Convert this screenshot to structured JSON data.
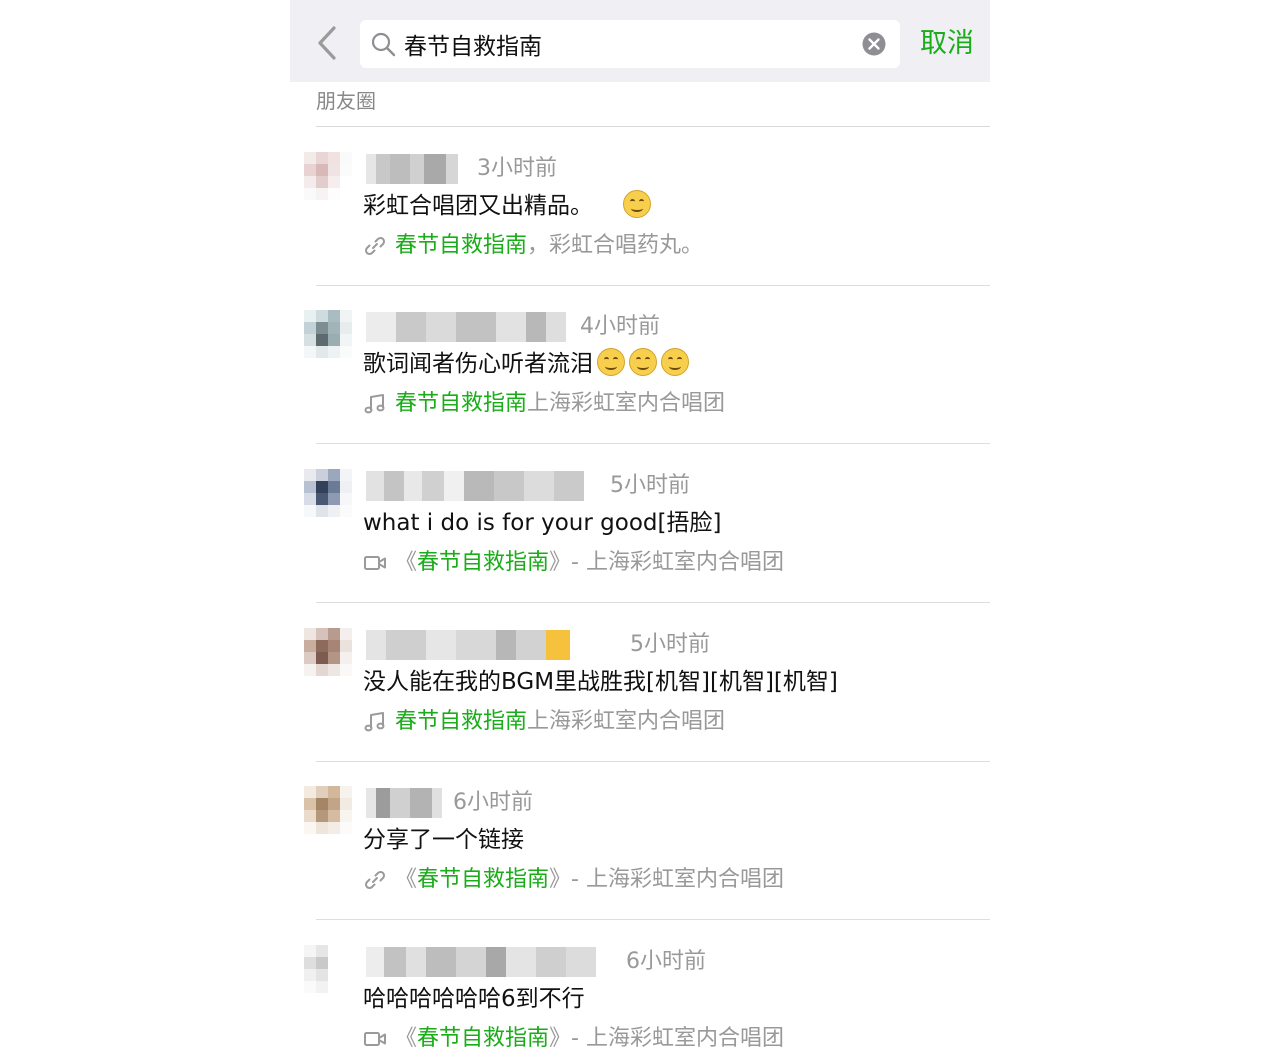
{
  "search": {
    "query": "春节自救指南",
    "cancel_label": "取消"
  },
  "section_label": "朋友圈",
  "results": [
    {
      "time": "3小时前",
      "text": "彩虹合唱团又出精品。",
      "emoji": "laughing-tears",
      "share_type": "link-icon",
      "share_prefix": "",
      "share_highlight": "春节自救指南",
      "share_rest": "，彩虹合唱药丸。"
    },
    {
      "time": "4小时前",
      "text": "歌词闻者伤心听者流泪",
      "emoji": "blush x3",
      "share_type": "music-icon",
      "share_prefix": "",
      "share_highlight": "春节自救指南",
      "share_rest": " 上海彩虹室内合唱团"
    },
    {
      "time": "5小时前",
      "text": "what i do is for your good[捂脸]",
      "share_type": "video-icon",
      "share_prefix": "《",
      "share_highlight": "春节自救指南",
      "share_rest": "》- 上海彩虹室内合唱团"
    },
    {
      "time": "5小时前",
      "text": "没人能在我的BGM里战胜我[机智][机智][机智]",
      "share_type": "music-icon",
      "share_prefix": "",
      "share_highlight": "春节自救指南",
      "share_rest": " 上海彩虹室内合唱团"
    },
    {
      "time": "6小时前",
      "text": "分享了一个链接",
      "share_type": "link-icon",
      "share_prefix": "《",
      "share_highlight": "春节自救指南",
      "share_rest": "》- 上海彩虹室内合唱团"
    },
    {
      "time": "6小时前",
      "text": "哈哈哈哈哈哈6到不行",
      "share_type": "video-icon",
      "share_prefix": "《",
      "share_highlight": "春节自救指南",
      "share_rest": "》- 上海彩虹室内合唱团"
    }
  ],
  "colors": {
    "accent": "#1aad19",
    "header_bg": "#efeff4",
    "muted": "#999999"
  }
}
